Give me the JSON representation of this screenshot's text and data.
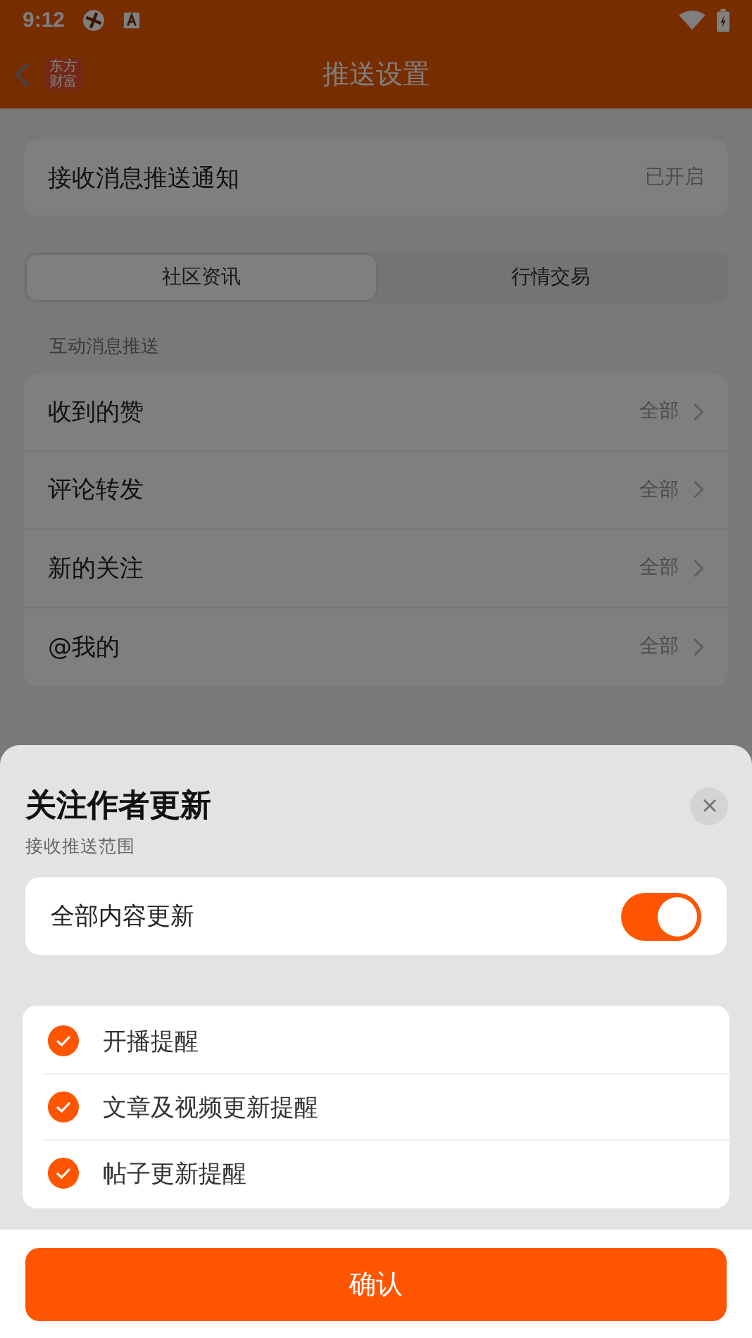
{
  "status_bar": {
    "time": "9:12"
  },
  "app_bar": {
    "logo_text": "东方财富",
    "title": "推送设置"
  },
  "master_setting": {
    "label": "接收消息推送通知",
    "value": "已开启"
  },
  "tabs": [
    {
      "label": "社区资讯",
      "selected": true
    },
    {
      "label": "行情交易",
      "selected": false
    }
  ],
  "section": {
    "title": "互动消息推送"
  },
  "rows": [
    {
      "label": "收到的赞",
      "value": "全部"
    },
    {
      "label": "评论转发",
      "value": "全部"
    },
    {
      "label": "新的关注",
      "value": "全部"
    },
    {
      "label": "@我的",
      "value": "全部"
    }
  ],
  "sheet": {
    "title": "关注作者更新",
    "subtitle": "接收推送范围",
    "toggle": {
      "label": "全部内容更新",
      "on": true
    },
    "options": [
      {
        "label": "开播提醒",
        "checked": true
      },
      {
        "label": "文章及视频更新提醒",
        "checked": true
      },
      {
        "label": "帖子更新提醒",
        "checked": true
      }
    ],
    "confirm": "确认"
  }
}
